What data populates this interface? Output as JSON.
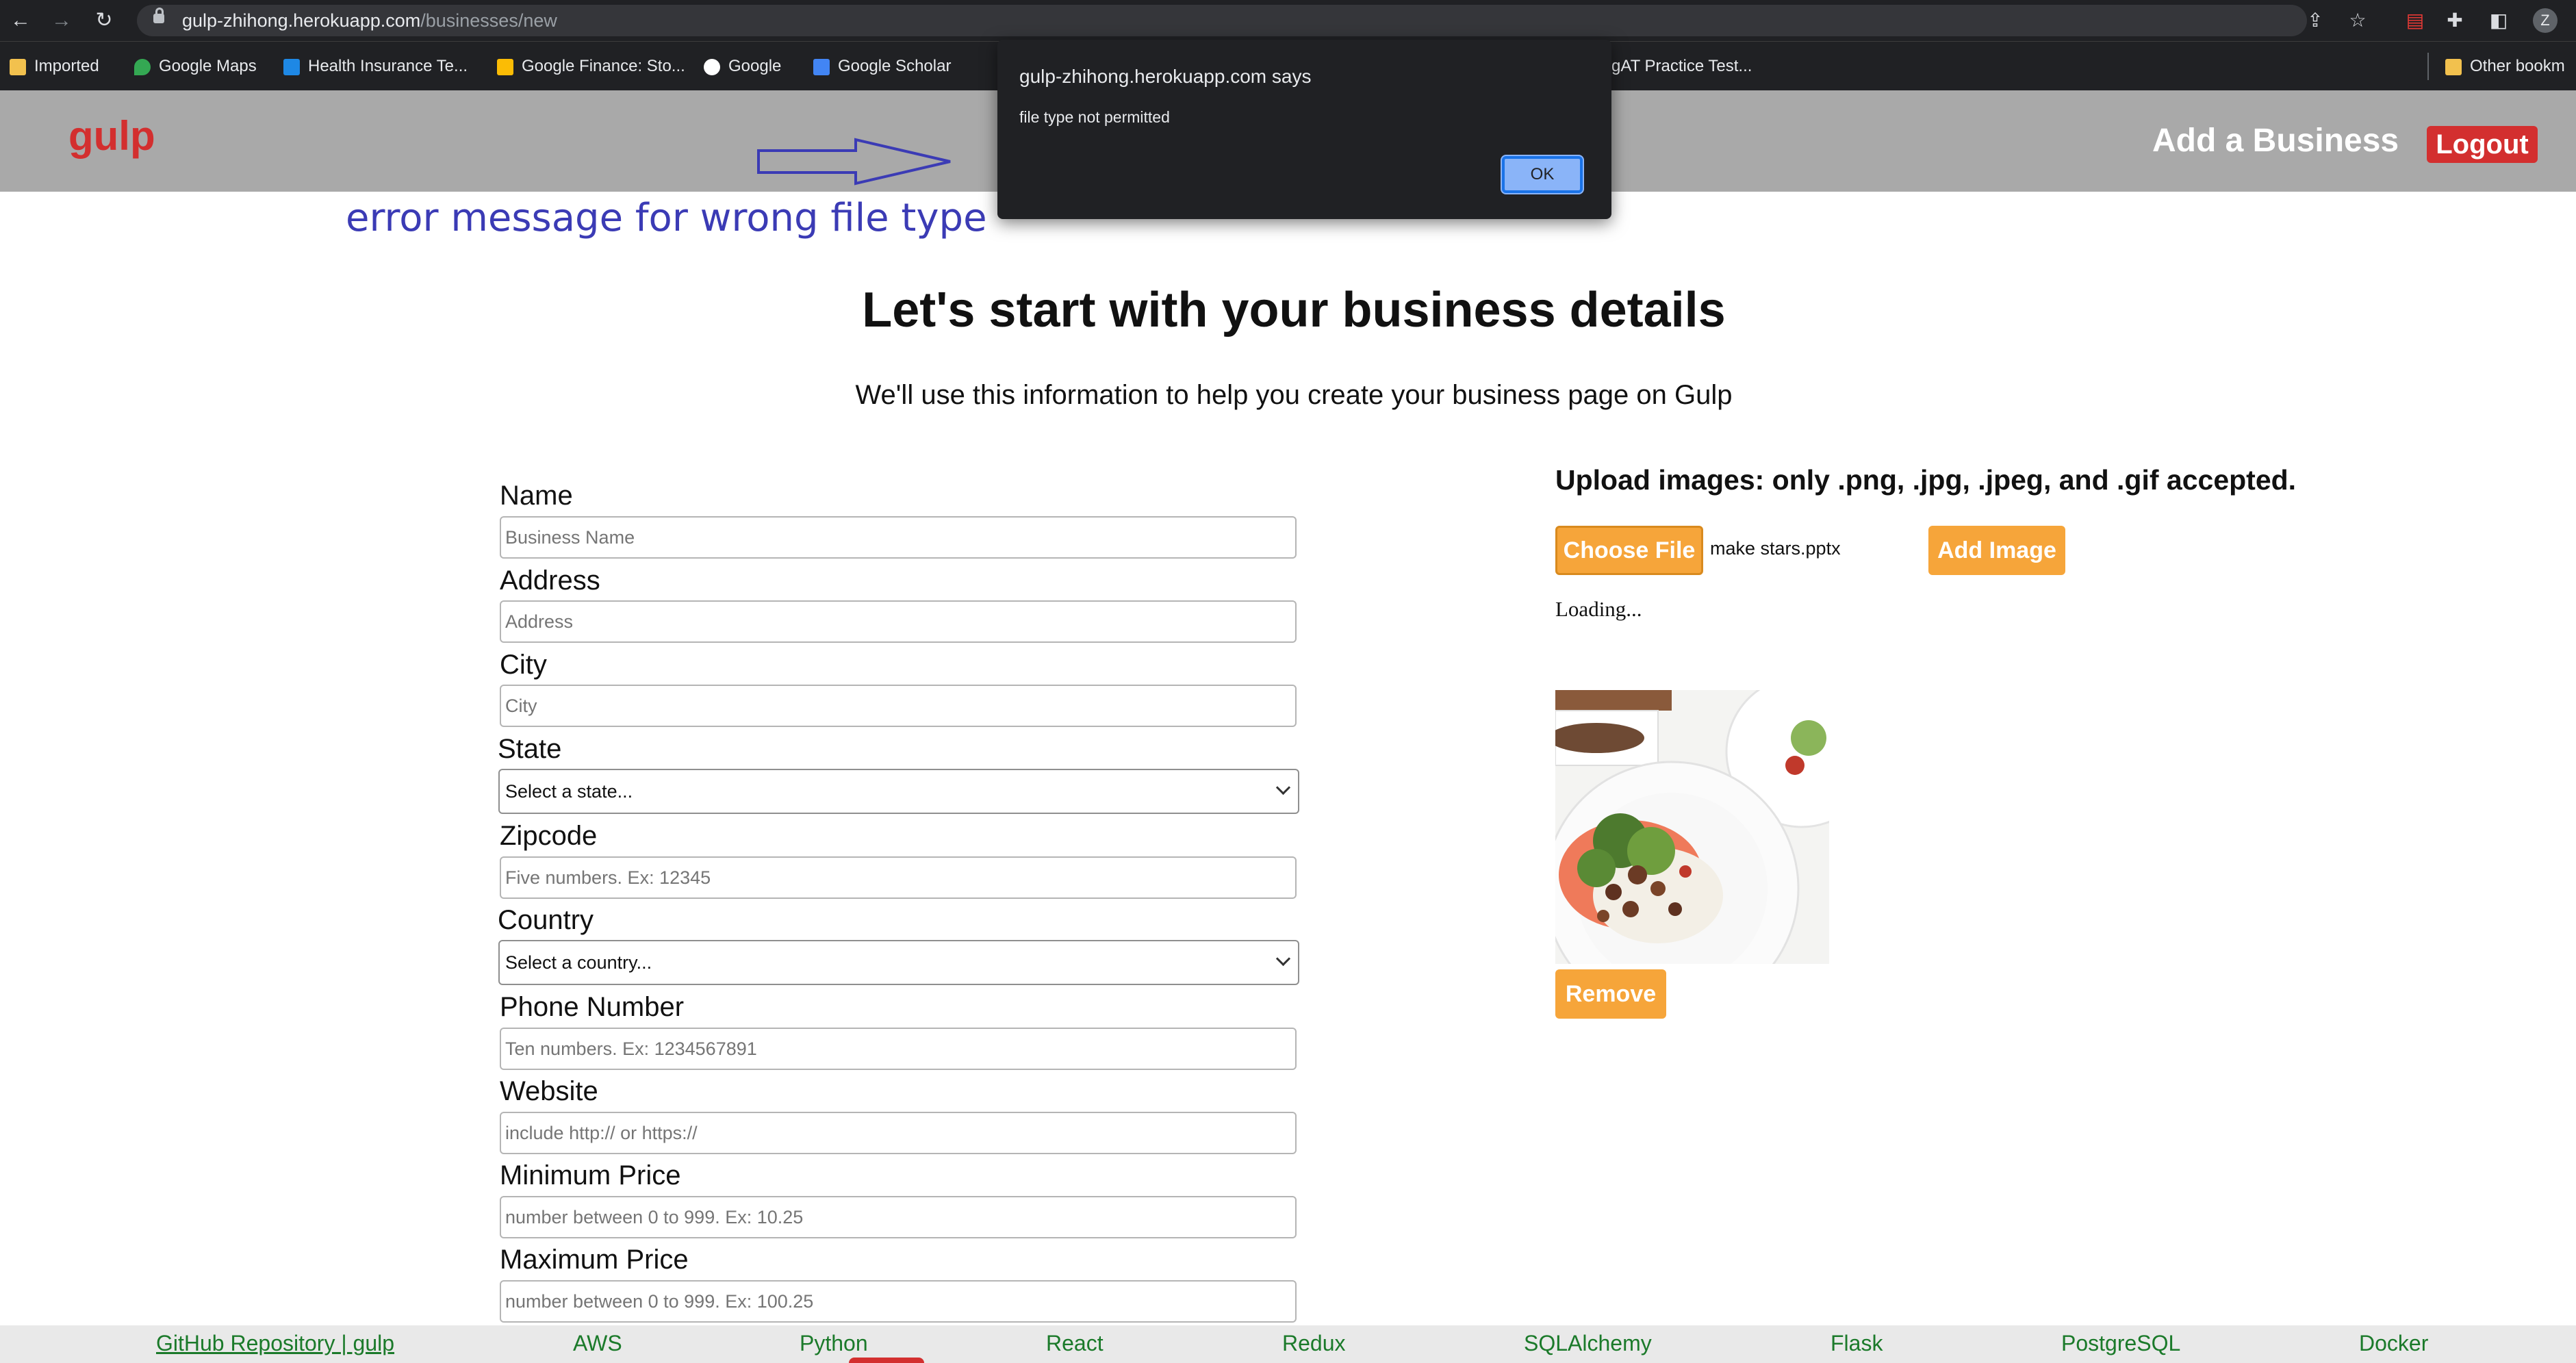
{
  "browser": {
    "url_host": "gulp-zhihong.herokuapp.com",
    "url_path": "/businesses/new",
    "profile_initial": "Z",
    "bookmarks": [
      {
        "label": "Imported"
      },
      {
        "label": "Google Maps"
      },
      {
        "label": "Health Insurance Te..."
      },
      {
        "label": "Google Finance: Sto..."
      },
      {
        "label": "Google"
      },
      {
        "label": "Google Scholar"
      },
      {
        "label": "gAT Practice Test..."
      },
      {
        "label": "Other bookm"
      }
    ]
  },
  "header": {
    "logo": "gulp",
    "add_business": "Add a Business",
    "logout": "Logout"
  },
  "annotation": {
    "text": "error message for wrong file type"
  },
  "dialog": {
    "title": "gulp-zhihong.herokuapp.com says",
    "message": "file type not permitted",
    "ok": "OK"
  },
  "page": {
    "title": "Let's start with your business details",
    "subtitle": "We'll use this information to help you create your business page on Gulp"
  },
  "form": {
    "name": {
      "label": "Name",
      "placeholder": "Business Name"
    },
    "address": {
      "label": "Address",
      "placeholder": "Address"
    },
    "city": {
      "label": "City",
      "placeholder": "City"
    },
    "state": {
      "label": "State",
      "value": "Select a state..."
    },
    "zipcode": {
      "label": "Zipcode",
      "placeholder": "Five numbers. Ex: 12345"
    },
    "country": {
      "label": "Country",
      "value": "Select a country..."
    },
    "phone": {
      "label": "Phone Number",
      "placeholder": "Ten numbers. Ex: 1234567891"
    },
    "website": {
      "label": "Website",
      "placeholder": "include http:// or https://"
    },
    "min_price": {
      "label": "Minimum Price",
      "placeholder": "number between 0 to 999. Ex: 10.25"
    },
    "max_price": {
      "label": "Maximum Price",
      "placeholder": "number between 0 to 999. Ex: 100.25"
    }
  },
  "upload": {
    "title": "Upload images: only .png, .jpg, .jpeg, and .gif accepted.",
    "choose_file": "Choose File",
    "file_name": "make stars.pptx",
    "add_image": "Add Image",
    "loading": "Loading...",
    "remove": "Remove"
  },
  "footer": {
    "links": [
      "GitHub Repository | gulp",
      "AWS",
      "Python",
      "React",
      "Redux",
      "SQLAlchemy",
      "Flask",
      "PostgreSQL",
      "Docker"
    ]
  },
  "colors": {
    "brand_red": "#d32f2f",
    "header_gray": "#a9a9a9",
    "button_orange": "#f6a53a",
    "annotation_blue": "#3b3bb5",
    "footer_green": "#1b7a2a"
  }
}
